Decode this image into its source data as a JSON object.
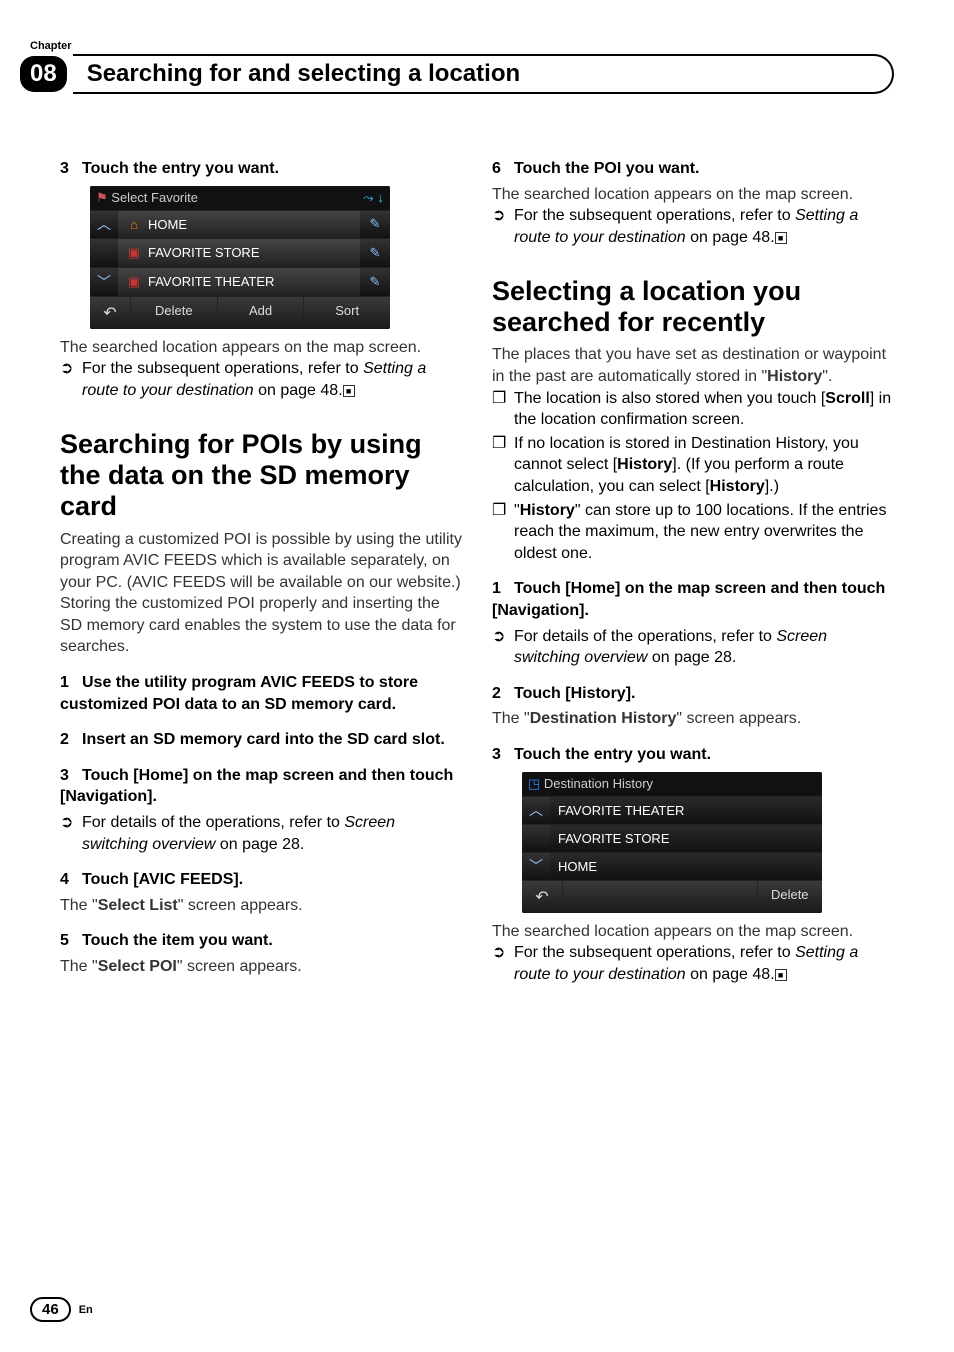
{
  "header": {
    "chapter_label": "Chapter",
    "chapter_num": "08",
    "title": "Searching for and selecting a location"
  },
  "left": {
    "step3": {
      "num": "3",
      "text": "Touch the entry you want."
    },
    "mock1": {
      "title": "Select Favorite",
      "rows": [
        "HOME",
        "FAVORITE STORE",
        "FAVORITE THEATER"
      ],
      "bottom": {
        "delete": "Delete",
        "add": "Add",
        "sort": "Sort"
      }
    },
    "after_mock1_p": "The searched location appears on the map screen.",
    "after_mock1_note_a": "For the subsequent operations, refer to ",
    "after_mock1_note_i": "Setting a route to your destination",
    "after_mock1_note_b": " on page 48.",
    "heading_poi": "Searching for POIs by using the data on the SD memory card",
    "poi_para": "Creating a customized POI is possible by using the utility program AVIC FEEDS which is available separately, on your PC. (AVIC FEEDS will be available on our website.) Storing the customized POI properly and inserting the SD memory card enables the system to use the data for searches.",
    "step1": {
      "num": "1",
      "text": "Use the utility program AVIC FEEDS to store customized POI data to an SD memory card."
    },
    "step2": {
      "num": "2",
      "text": "Insert an SD memory card into the SD card slot."
    },
    "step3b": {
      "num": "3",
      "text": "Touch [Home] on the map screen and then touch [Navigation]."
    },
    "step3b_note_a": "For details of the operations, refer to ",
    "step3b_note_i": "Screen switching overview",
    "step3b_note_b": " on page 28.",
    "step4": {
      "num": "4",
      "text": "Touch [AVIC FEEDS]."
    },
    "step4_after_a": "The \"",
    "step4_after_bold": "Select List",
    "step4_after_b": "\" screen appears.",
    "step5": {
      "num": "5",
      "text": "Touch the item you want."
    },
    "step5_after_a": "The \"",
    "step5_after_bold": "Select POI",
    "step5_after_b": "\" screen appears."
  },
  "right": {
    "step6": {
      "num": "6",
      "text": "Touch the POI you want."
    },
    "step6_p": "The searched location appears on the map screen.",
    "step6_note_a": "For the subsequent operations, refer to ",
    "step6_note_i": "Setting a route to your destination",
    "step6_note_b": " on page 48.",
    "heading_recent": "Selecting a location you searched for recently",
    "recent_p_a": "The places that you have set as destination or waypoint in the past are automatically stored in \"",
    "recent_p_bold": "History",
    "recent_p_b": "\".",
    "bullet1_a": "The location is also stored when you touch [",
    "bullet1_bold": "Scroll",
    "bullet1_b": "] in the location confirmation screen.",
    "bullet2_a": "If no location is stored in Destination History, you cannot select [",
    "bullet2_bold1": "History",
    "bullet2_b": "]. (If you perform a route calculation, you can select [",
    "bullet2_bold2": "History",
    "bullet2_c": "].)",
    "bullet3_a": "\"",
    "bullet3_bold": "History",
    "bullet3_b": "\" can store up to 100 locations. If the entries reach the maximum, the new entry overwrites the oldest one.",
    "step1": {
      "num": "1",
      "text": "Touch [Home] on the map screen and then touch [Navigation]."
    },
    "step1_note_a": "For details of the operations, refer to ",
    "step1_note_i": "Screen switching overview",
    "step1_note_b": " on page 28.",
    "step2": {
      "num": "2",
      "text": "Touch [History]."
    },
    "step2_after_a": "The \"",
    "step2_after_bold": "Destination History",
    "step2_after_b": "\" screen appears.",
    "step3": {
      "num": "3",
      "text": "Touch the entry you want."
    },
    "mock2": {
      "title": "Destination History",
      "rows": [
        "FAVORITE THEATER",
        "FAVORITE STORE",
        "HOME"
      ],
      "bottom": {
        "delete": "Delete"
      }
    },
    "after_mock2_p": "The searched location appears on the map screen.",
    "after_mock2_note_a": "For the subsequent operations, refer to ",
    "after_mock2_note_i": "Setting a route to your destination",
    "after_mock2_note_b": " on page 48."
  },
  "footer": {
    "page": "46",
    "lang": "En"
  },
  "end_box_glyph": "■"
}
